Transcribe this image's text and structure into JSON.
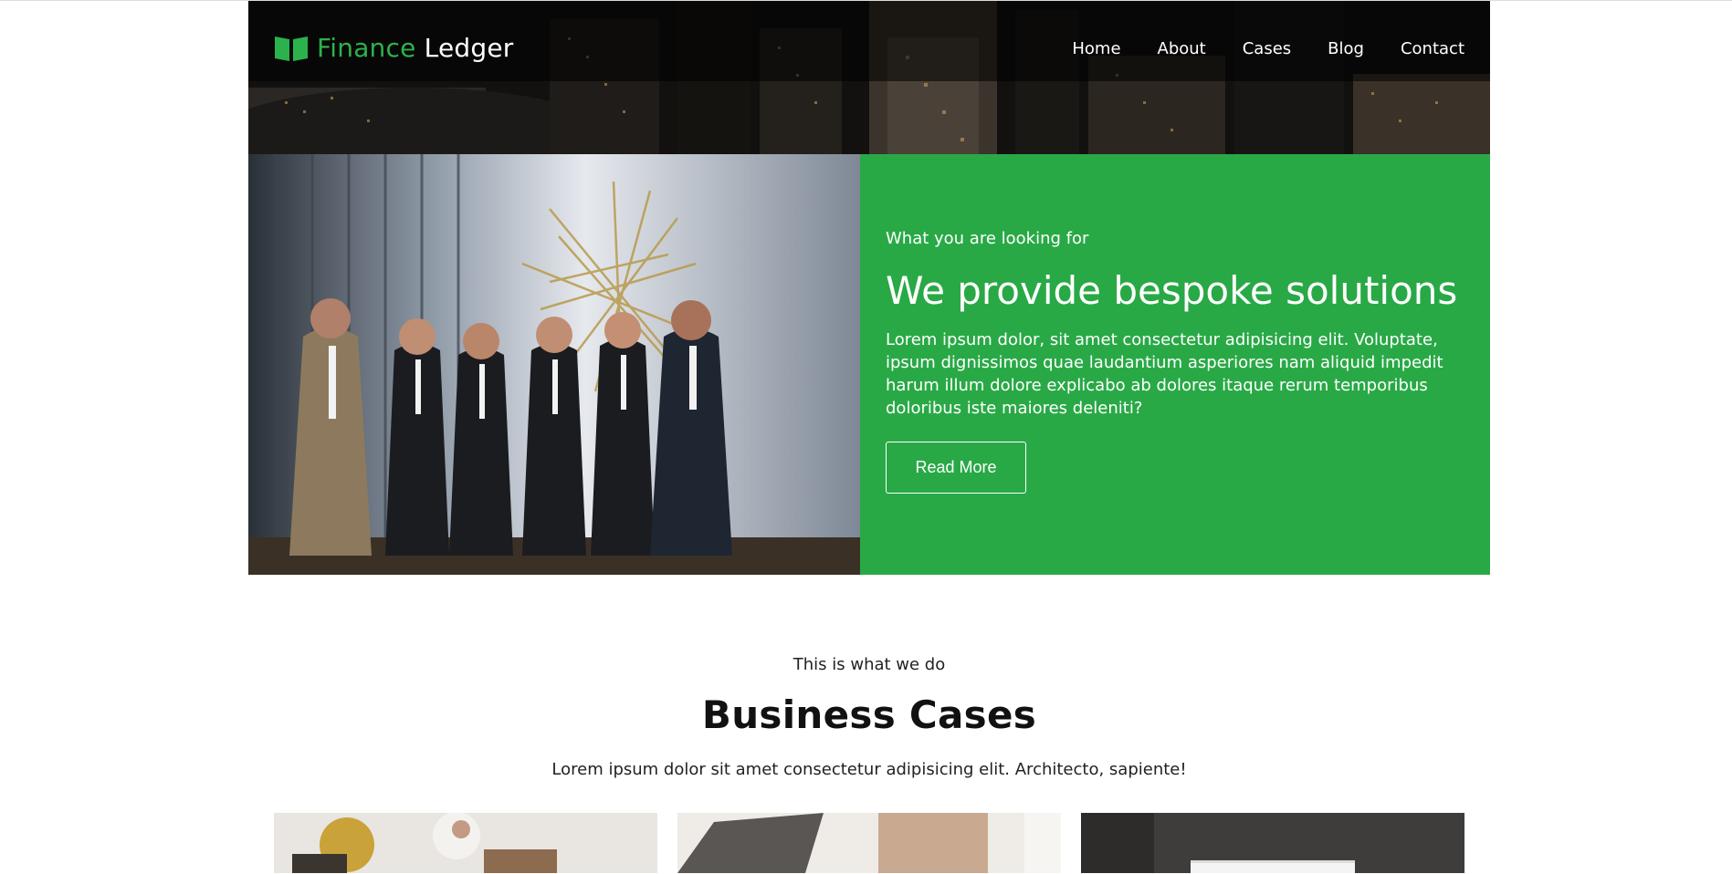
{
  "brand": {
    "name_part1": "Finance",
    "name_part2": "Ledger",
    "icon": "open-book-icon",
    "accent_color": "#2bb24c"
  },
  "nav": {
    "items": [
      {
        "label": "Home"
      },
      {
        "label": "About"
      },
      {
        "label": "Cases"
      },
      {
        "label": "Blog"
      },
      {
        "label": "Contact"
      }
    ]
  },
  "hero": {
    "eyebrow": "What you are looking for",
    "headline": "We provide bespoke solutions",
    "body": "Lorem ipsum dolor, sit amet consectetur adipisicing elit. Voluptate, ipsum dignissimos quae laudantium asperiores nam aliquid impedit harum illum dolore explicabo ab dolores itaque rerum temporibus doloribus iste maiores deleniti?",
    "button_label": "Read More",
    "panel_color": "#29a946"
  },
  "cases": {
    "eyebrow": "This is what we do",
    "title": "Business Cases",
    "subtitle": "Lorem ipsum dolor sit amet consectetur adipisicing elit. Architecto, sapiente!"
  }
}
